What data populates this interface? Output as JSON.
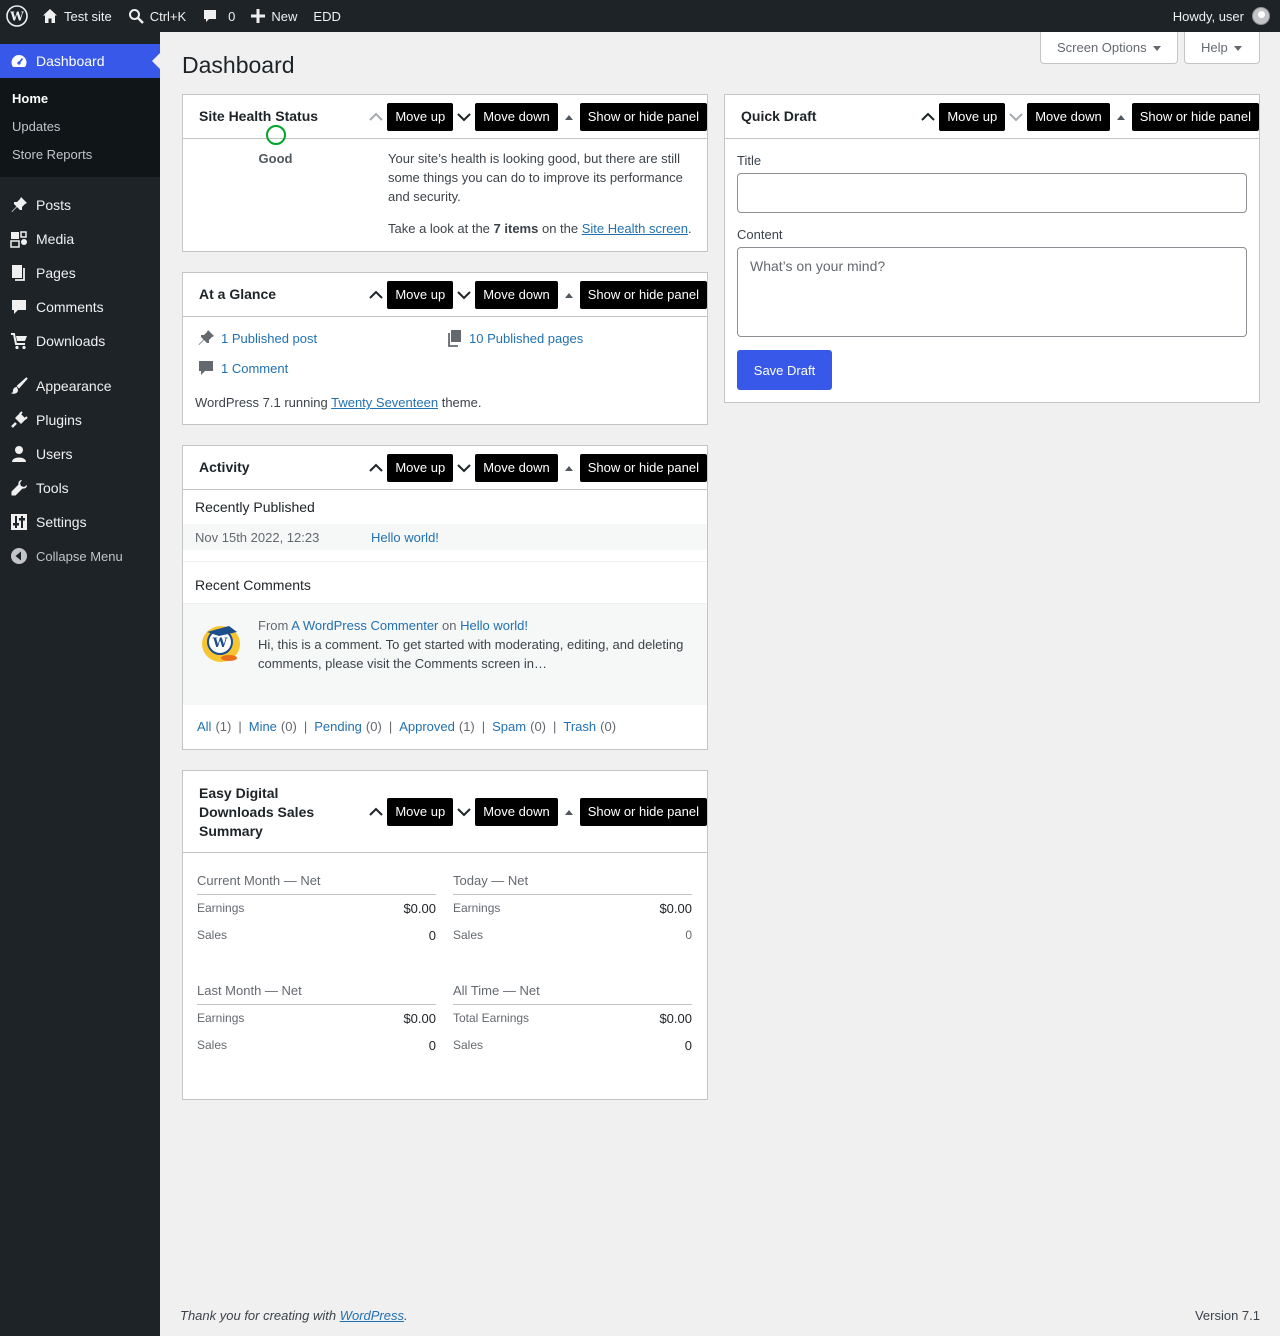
{
  "adminbar": {
    "site_name": "Test site",
    "search_shortcut": "Ctrl+K",
    "comments_count": "0",
    "new_label": "New",
    "edd_label": "EDD",
    "howdy": "Howdy, user"
  },
  "sidebar": {
    "dashboard": "Dashboard",
    "submenu": [
      "Home",
      "Updates",
      "Store Reports"
    ],
    "items": [
      "Posts",
      "Media",
      "Pages",
      "Comments",
      "Downloads",
      "Appearance",
      "Plugins",
      "Users",
      "Tools",
      "Settings"
    ],
    "collapse": "Collapse Menu"
  },
  "page": {
    "title": "Dashboard",
    "screen_options": "Screen Options",
    "help": "Help"
  },
  "actions": {
    "move_up": "Move up",
    "move_down": "Move down",
    "toggle": "Show or hide panel"
  },
  "site_health": {
    "title": "Site Health Status",
    "status": "Good",
    "message": "Your site’s health is looking good, but there are still some things you can do to improve its performance and security.",
    "look_pre": "Take a look at the",
    "items": "7 items",
    "look_mid": "on the",
    "link": "Site Health screen",
    "period": "."
  },
  "glance": {
    "title": "At a Glance",
    "posts": "1 Published post",
    "pages": "10 Published pages",
    "comments": "1 Comment",
    "running_pre": "WordPress 7.1 running",
    "theme": "Twenty Seventeen",
    "running_post": "theme."
  },
  "activity": {
    "title": "Activity",
    "recently_published": "Recently Published",
    "post_date": "Nov 15th 2022, 12:23",
    "post_title": "Hello world!",
    "recent_comments": "Recent Comments",
    "comment_from": "From",
    "commenter": "A WordPress Commenter",
    "on": "on",
    "comment_post": "Hello world!",
    "comment_text": "Hi, this is a comment. To get started with moderating, editing, and deleting comments, please visit the Comments screen in…",
    "filters": [
      {
        "label": "All",
        "count": "(1)"
      },
      {
        "label": "Mine",
        "count": "(0)"
      },
      {
        "label": "Pending",
        "count": "(0)"
      },
      {
        "label": "Approved",
        "count": "(1)"
      },
      {
        "label": "Spam",
        "count": "(0)"
      },
      {
        "label": "Trash",
        "count": "(0)"
      }
    ],
    "sep": "|"
  },
  "edd": {
    "title_lines": [
      "Easy Digital",
      "Downloads Sales",
      "Summary"
    ],
    "blocks": [
      {
        "heading": "Current Month — Net",
        "rows": [
          {
            "label": "Earnings",
            "value": "$0.00"
          },
          {
            "label": "Sales",
            "value": "0"
          }
        ]
      },
      {
        "heading": "Today — Net",
        "rows": [
          {
            "label": "Earnings",
            "value": "$0.00"
          },
          {
            "label": "Sales",
            "value": "0"
          }
        ]
      },
      {
        "heading": "Last Month — Net",
        "rows": [
          {
            "label": "Earnings",
            "value": "$0.00"
          },
          {
            "label": "Sales",
            "value": "0"
          }
        ]
      },
      {
        "heading": "All Time — Net",
        "rows": [
          {
            "label": "Total Earnings",
            "value": "$0.00"
          },
          {
            "label": "Sales",
            "value": "0"
          }
        ]
      }
    ]
  },
  "quick_draft": {
    "title": "Quick Draft",
    "title_label": "Title",
    "title_value": "",
    "content_label": "Content",
    "content_placeholder": "What’s on your mind?",
    "save": "Save Draft"
  },
  "footer": {
    "thanks_pre": "Thank you for creating with",
    "wordpress": "WordPress",
    "thanks_post": ".",
    "version": "Version 7.1"
  }
}
